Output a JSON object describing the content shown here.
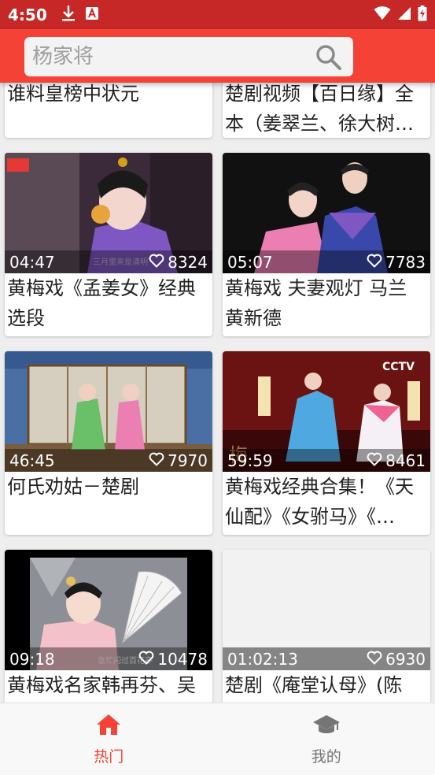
{
  "status_bar": {
    "time": "4:50"
  },
  "search": {
    "placeholder": "杨家将"
  },
  "partial_cards": [
    {
      "title": "谁料皇榜中状元"
    },
    {
      "title": "楚剧视频【百日缘】全本（姜翠兰、徐大树…"
    }
  ],
  "videos": [
    {
      "duration": "04:47",
      "likes": "8324",
      "title": "黄梅戏《孟姜女》经典选段",
      "caption": "三月里来是清明"
    },
    {
      "duration": "05:07",
      "likes": "7783",
      "title": "黄梅戏 夫妻观灯 马兰 黄新德"
    },
    {
      "duration": "46:45",
      "likes": "7970",
      "title": "何氏劝姑－楚剧"
    },
    {
      "duration": "59:59",
      "likes": "8461",
      "title": "黄梅戏经典合集！《天仙配》《女驸马》《…",
      "caption": "CCTV"
    },
    {
      "duration": "09:18",
      "likes": "10478",
      "title": "黄梅戏名家韩再芬、吴",
      "caption": "急忙闪过百花亭"
    },
    {
      "duration": "01:02:13",
      "likes": "6930",
      "title": "楚剧《庵堂认母》(陈"
    }
  ],
  "bottom_nav": {
    "hot_label": "热门",
    "mine_label": "我的"
  },
  "colors": {
    "primary": "#f44336",
    "status_bar": "#c62828"
  }
}
